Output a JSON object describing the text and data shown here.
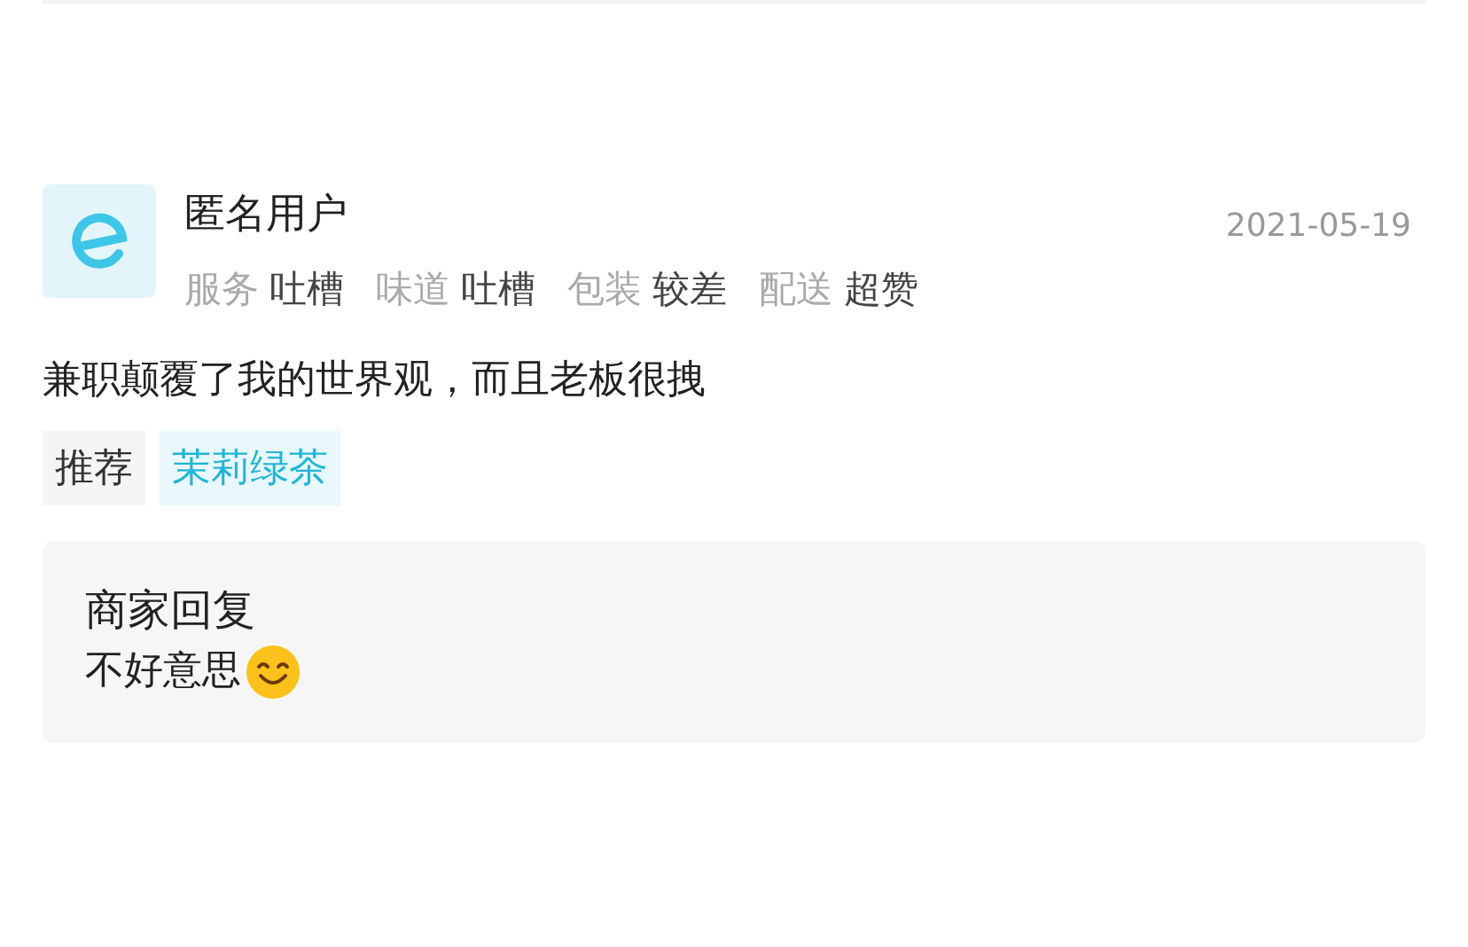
{
  "review": {
    "user": "匿名用户",
    "date": "2021-05-19",
    "ratings": [
      {
        "label": "服务",
        "value": "吐槽"
      },
      {
        "label": "味道",
        "value": "吐槽"
      },
      {
        "label": "包装",
        "value": "较差"
      },
      {
        "label": "配送",
        "value": "超赞"
      }
    ],
    "text": "兼职颠覆了我的世界观，而且老板很拽",
    "tags": [
      {
        "kind": "label",
        "text": "推荐"
      },
      {
        "kind": "item",
        "text": "茉莉绿茶"
      }
    ],
    "reply": {
      "title": "商家回复",
      "text": "不好意思"
    }
  }
}
